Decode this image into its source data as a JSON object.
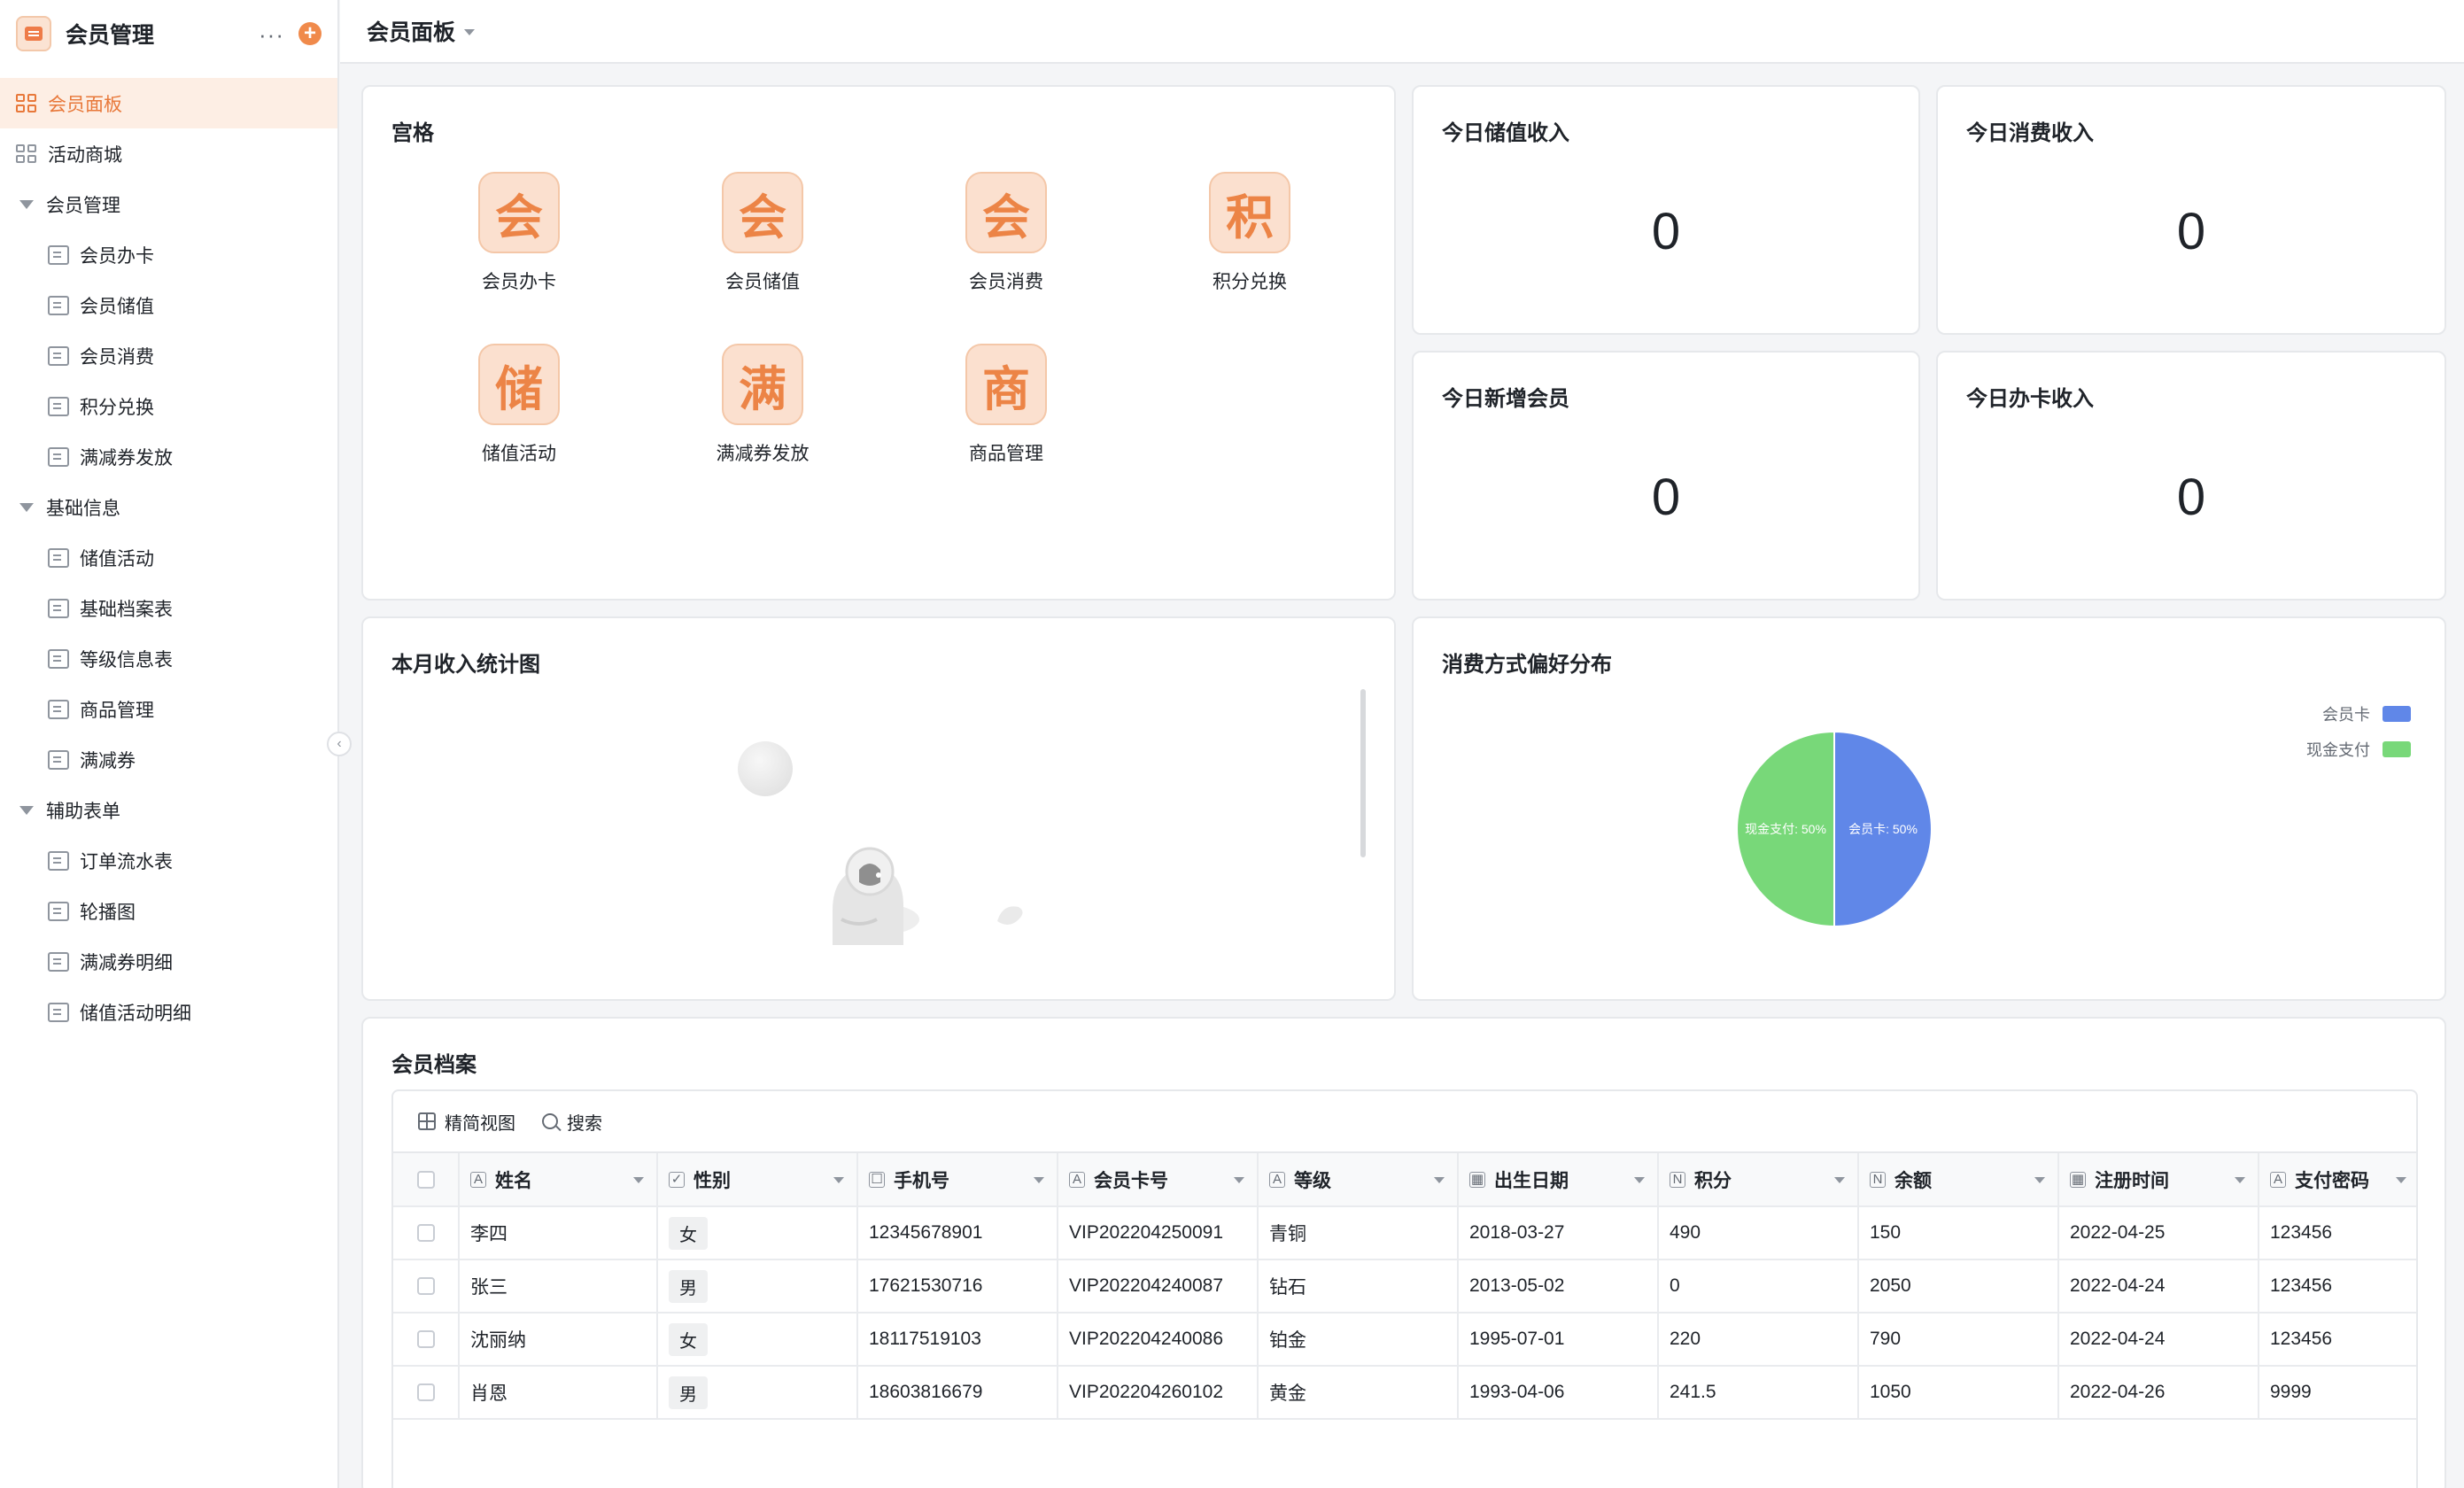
{
  "app": {
    "title": "会员管理"
  },
  "page": {
    "title": "会员面板"
  },
  "sidebar": {
    "items": [
      {
        "label": "会员面板",
        "level": 0,
        "type": "dashboard",
        "active": true
      },
      {
        "label": "活动商城",
        "level": 0,
        "type": "dashboard"
      },
      {
        "label": "会员管理",
        "level": 0,
        "type": "group"
      },
      {
        "label": "会员办卡",
        "level": 1,
        "type": "form"
      },
      {
        "label": "会员储值",
        "level": 1,
        "type": "form"
      },
      {
        "label": "会员消费",
        "level": 1,
        "type": "form"
      },
      {
        "label": "积分兑换",
        "level": 1,
        "type": "form"
      },
      {
        "label": "满减券发放",
        "level": 1,
        "type": "form"
      },
      {
        "label": "基础信息",
        "level": 0,
        "type": "group"
      },
      {
        "label": "储值活动",
        "level": 1,
        "type": "form"
      },
      {
        "label": "基础档案表",
        "level": 1,
        "type": "form"
      },
      {
        "label": "等级信息表",
        "level": 1,
        "type": "form"
      },
      {
        "label": "商品管理",
        "level": 1,
        "type": "form"
      },
      {
        "label": "满减券",
        "level": 1,
        "type": "form"
      },
      {
        "label": "辅助表单",
        "level": 0,
        "type": "group"
      },
      {
        "label": "订单流水表",
        "level": 1,
        "type": "form"
      },
      {
        "label": "轮播图",
        "level": 1,
        "type": "form"
      },
      {
        "label": "满减券明细",
        "level": 1,
        "type": "form"
      },
      {
        "label": "储值活动明细",
        "level": 1,
        "type": "form"
      }
    ]
  },
  "grid_card": {
    "title": "宫格",
    "items": [
      {
        "glyph": "会",
        "label": "会员办卡"
      },
      {
        "glyph": "会",
        "label": "会员储值"
      },
      {
        "glyph": "会",
        "label": "会员消费"
      },
      {
        "glyph": "积",
        "label": "积分兑换"
      },
      {
        "glyph": "储",
        "label": "储值活动"
      },
      {
        "glyph": "满",
        "label": "满减券发放"
      },
      {
        "glyph": "商",
        "label": "商品管理"
      }
    ]
  },
  "stats": [
    {
      "title": "今日储值收入",
      "value": "0"
    },
    {
      "title": "今日消费收入",
      "value": "0"
    },
    {
      "title": "今日新增会员",
      "value": "0"
    },
    {
      "title": "今日办卡收入",
      "value": "0"
    }
  ],
  "income_chart": {
    "title": "本月收入统计图"
  },
  "chart_data": {
    "type": "pie",
    "title": "消费方式偏好分布",
    "series": [
      {
        "name": "会员卡",
        "value": 50,
        "label": "会员卡: 50%",
        "color": "#6087e8"
      },
      {
        "name": "现金支付",
        "value": 50,
        "label": "现金支付: 50%",
        "color": "#78d879"
      }
    ],
    "legend_position": "top-right"
  },
  "member_table": {
    "title": "会员档案",
    "toolbar": {
      "view_label": "精简视图",
      "search_label": "搜索"
    },
    "columns": [
      {
        "label": "姓名",
        "icon": "A"
      },
      {
        "label": "性别",
        "icon": "✓"
      },
      {
        "label": "手机号",
        "icon": "☐"
      },
      {
        "label": "会员卡号",
        "icon": "A"
      },
      {
        "label": "等级",
        "icon": "A"
      },
      {
        "label": "出生日期",
        "icon": "▦"
      },
      {
        "label": "积分",
        "icon": "N"
      },
      {
        "label": "余额",
        "icon": "N"
      },
      {
        "label": "注册时间",
        "icon": "▦"
      },
      {
        "label": "支付密码",
        "icon": "A"
      }
    ],
    "rows": [
      [
        "李四",
        "女",
        "12345678901",
        "VIP202204250091",
        "青铜",
        "2018-03-27",
        "490",
        "150",
        "2022-04-25",
        "123456"
      ],
      [
        "张三",
        "男",
        "17621530716",
        "VIP202204240087",
        "钻石",
        "2013-05-02",
        "0",
        "2050",
        "2022-04-24",
        "123456"
      ],
      [
        "沈丽纳",
        "女",
        "18117519103",
        "VIP202204240086",
        "铂金",
        "1995-07-01",
        "220",
        "790",
        "2022-04-24",
        "123456"
      ],
      [
        "肖恩",
        "男",
        "18603816679",
        "VIP202204260102",
        "黄金",
        "1993-04-06",
        "241.5",
        "1050",
        "2022-04-26",
        "9999"
      ]
    ]
  }
}
